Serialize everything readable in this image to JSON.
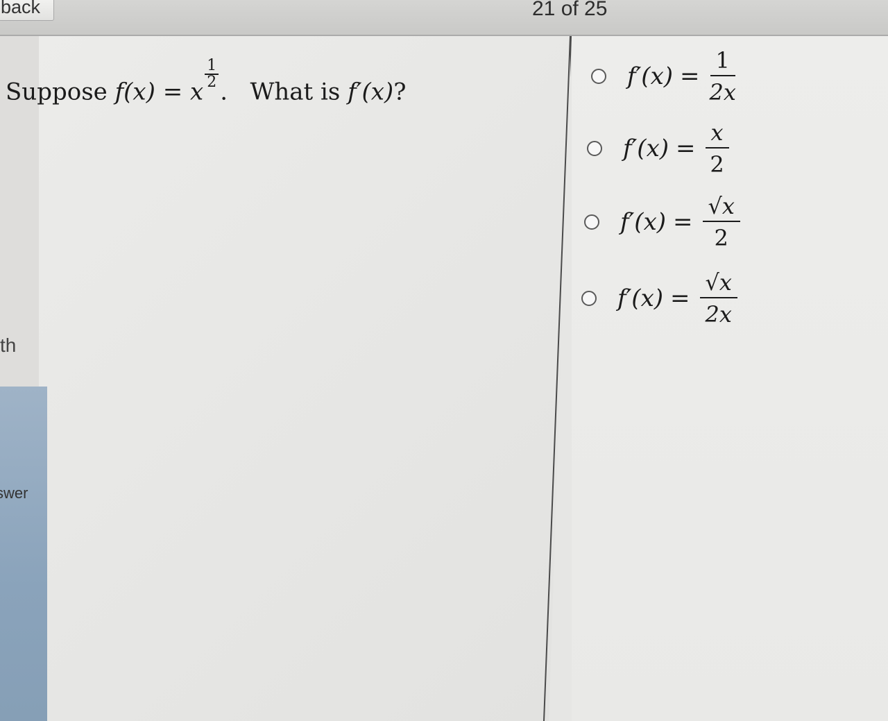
{
  "header": {
    "back_label": "back",
    "progress_text": "21 of 25"
  },
  "side_panel": {
    "fragment_a": "th",
    "fragment_b": "swer"
  },
  "question": {
    "lead": "Suppose",
    "function_lhs": "f(x)",
    "equals": "=",
    "base": "x",
    "exponent_numerator": "1",
    "exponent_denominator": "2",
    "period": ".",
    "prompt": "What is",
    "target": "f′(x)",
    "question_mark": "?"
  },
  "options": [
    {
      "lhs": "f′(x)",
      "eq": "=",
      "numerator": "1",
      "denominator": "2x"
    },
    {
      "lhs": "f′(x)",
      "eq": "=",
      "numerator": "x",
      "denominator": "2"
    },
    {
      "lhs": "f′(x)",
      "eq": "=",
      "numerator": "√x",
      "denominator": "2"
    },
    {
      "lhs": "f′(x)",
      "eq": "=",
      "numerator": "√x",
      "denominator": "2x"
    }
  ]
}
